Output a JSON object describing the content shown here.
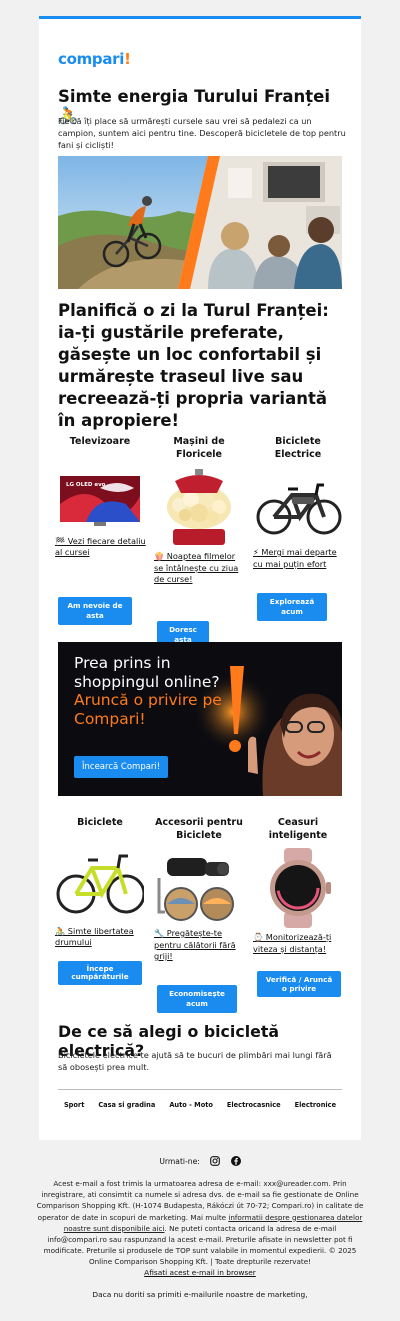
{
  "brand": {
    "name": "compari",
    "bang": "!"
  },
  "header": {
    "title": "Simte energia Turului Franței 🚴",
    "intro": "Fie că îți place să urmărești cursele sau vrei să pedalezi ca un campion, suntem aici pentru tine. Descoperă bicicletele de top pentru fani și cicliști!"
  },
  "plan_heading": "Planifică o zi la Turul Franței: ia-ți gustările preferate, găsește un loc confortabil și urmărește traseul live sau recreează-ți propria variantă în apropiere!",
  "row1": [
    {
      "title": "Televizoare",
      "desc": "🏁 Vezi fiecare detaliu al cursei",
      "button": "Am nevoie de asta",
      "tv_brand": "LG OLED evo"
    },
    {
      "title": "Mașini de Floricele",
      "desc": "🍿 Noaptea filmelor se întâlnește cu ziua de curse!",
      "button": "Doresc asta"
    },
    {
      "title": "Biciclete Electrice",
      "desc": "⚡ Mergi mai departe cu mai puțin efort",
      "button": "Explorează acum"
    }
  ],
  "promo": {
    "line1": "Prea prins in shoppingul online?",
    "line2": "Aruncă o privire pe Compari!",
    "button": "Încearcă Compari!"
  },
  "row2": [
    {
      "title": "Biciclete",
      "desc": "🚴 Simte libertatea drumului",
      "button": "Începe cumpărăturile"
    },
    {
      "title": "Accesorii pentru Biciclete",
      "desc": "🔧 Pregătește-te pentru călătorii fără griji!",
      "button": "Economisește acum"
    },
    {
      "title": "Ceasuri inteligente",
      "desc": "⌚ Monitorizează-ți viteza și distanța!",
      "button": "Verifică / Aruncă o privire"
    }
  ],
  "why": {
    "title": "De ce să alegi o bicicletă electrică?",
    "text": "Bicicletele electrice te ajută să te bucuri de plimbări mai lungi fără să obosești prea mult."
  },
  "categories": [
    "Sport",
    "Casa si gradina",
    "Auto - Moto",
    "Electrocasnice",
    "Electronice"
  ],
  "follow": {
    "label": "Urmati-ne:",
    "icons": [
      "instagram-icon",
      "facebook-icon"
    ]
  },
  "footer": {
    "text1": "Acest e-mail a fost trimis la urmatoarea adresa de e-mail: xxx@ureader.com. Prin inregistrare, ati consimtit ca numele si adresa dvs. de e-mail sa fie gestionate de Online Comparison Shopping Kft. (H-1074 Budapesta, Rákóczi út 70-72; Compari.ro) in calitate de operator de date in scopuri de marketing. Mai multe ",
    "link": "informatii despre gestionarea datelor noastre sunt disponibile aici",
    "text2": ". Ne puteti contacta oricand la adresa de e-mail info@compari.ro sau raspunzand la acest e-mail. Preturile afisate in newsletter pot fi modificate. Preturile si produsele de TOP sunt valabile in momentul expedierii. © 2025 Online Comparison Shopping Kft. | Toate drepturile rezervate!",
    "browser": "Afisati acest e-mail in browser",
    "unsub": "Daca nu doriti sa primiti e-mailurile noastre de marketing,"
  },
  "colors": {
    "accent": "#1a8cf0",
    "brand_orange": "#ff7a1a"
  }
}
